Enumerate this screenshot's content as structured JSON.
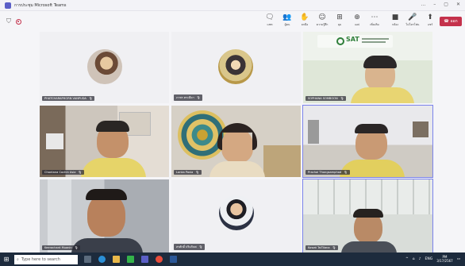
{
  "window": {
    "title": "การประชุม Microsoft Teams",
    "controls": [
      "...",
      "–",
      "▢",
      "✕"
    ]
  },
  "toolbar": {
    "buttons": [
      {
        "label": "แชท",
        "icon": "chat-icon",
        "glyph": "🗨"
      },
      {
        "label": "ผู้คน",
        "icon": "people-icon",
        "glyph": "👥"
      },
      {
        "label": "ยกมือ",
        "icon": "raise-hand-icon",
        "glyph": "✋"
      },
      {
        "label": "ความรู้สึก",
        "icon": "reactions-icon",
        "glyph": "☺"
      },
      {
        "label": "มุม",
        "icon": "view-icon",
        "glyph": "⊞"
      },
      {
        "label": "แอป",
        "icon": "apps-icon",
        "glyph": "⊕"
      },
      {
        "label": "เพิ่มเติม",
        "icon": "more-icon",
        "glyph": "⋯"
      },
      {
        "label": "กล้อง",
        "icon": "camera-icon",
        "glyph": "■"
      },
      {
        "label": "ไม่โครโฟน",
        "icon": "mic-icon",
        "glyph": "🎤"
      },
      {
        "label": "แชร์",
        "icon": "share-icon",
        "glyph": "⬆"
      }
    ],
    "leave_label": "ออก"
  },
  "participants": [
    {
      "name": "PHATCHARAPHORN VANPUDA",
      "muted": true
    },
    {
      "name": "ภาพร ตระดีดา",
      "muted": true
    },
    {
      "name": "SOPHANA SOMBOON",
      "muted": true
    },
    {
      "name": "Chantana Cochin Asia",
      "muted": true
    },
    {
      "name": "Lanka Pavia",
      "muted": true
    },
    {
      "name": "Prachai Thongsamphad",
      "muted": true
    },
    {
      "name": "Keerachant Muanin",
      "muted": true
    },
    {
      "name": "สรศักดิ์ ปริมกินพ",
      "muted": true
    },
    {
      "name": "Kowat TaiTilana",
      "muted": true
    }
  ],
  "content_text": {
    "sat_logo": "SAT"
  },
  "taskbar": {
    "search_placeholder": "Type here to search",
    "time": "PM",
    "date": "3/17/2567",
    "lang": "ENG"
  }
}
